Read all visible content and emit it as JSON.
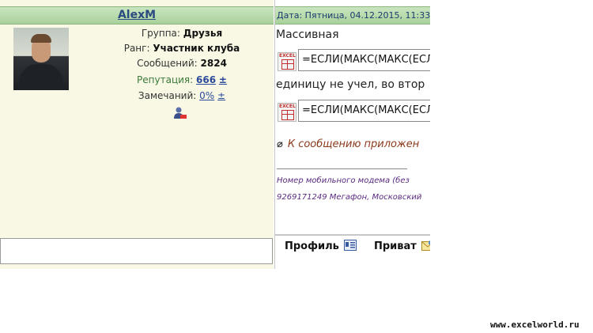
{
  "post": {
    "username": "AlexM",
    "date": "Дата: Пятница, 04.12.2015, 11:33",
    "group_label": "Группа:",
    "group_value": "Друзья",
    "rank_label": "Ранг:",
    "rank_value": "Участник клуба",
    "messages_label": "Сообщений:",
    "messages_value": "2824",
    "reputation_label": "Репутация:",
    "reputation_value": "666",
    "reputation_pm": "±",
    "remarks_label": "Замечаний:",
    "remarks_value": "0%",
    "remarks_pm": "±"
  },
  "body": {
    "line1": "Массивная",
    "formula1": "=ЕСЛИ(МАКС(МАКС(ЕСЛ",
    "line2": "единицу не учел, во втор",
    "formula2": "=ЕСЛИ(МАКС(МАКС(ЕСЛ",
    "excel_icon_label": "EXCEL",
    "attachment_text": "К сообщению приложен",
    "signature_line1": "Номер мобильного модема  (без",
    "signature_line2": "9269171249 Мегафон,  Московский"
  },
  "actions": {
    "profile": "Профиль",
    "private": "Приват"
  },
  "watermark": "www.excelworld.ru"
}
